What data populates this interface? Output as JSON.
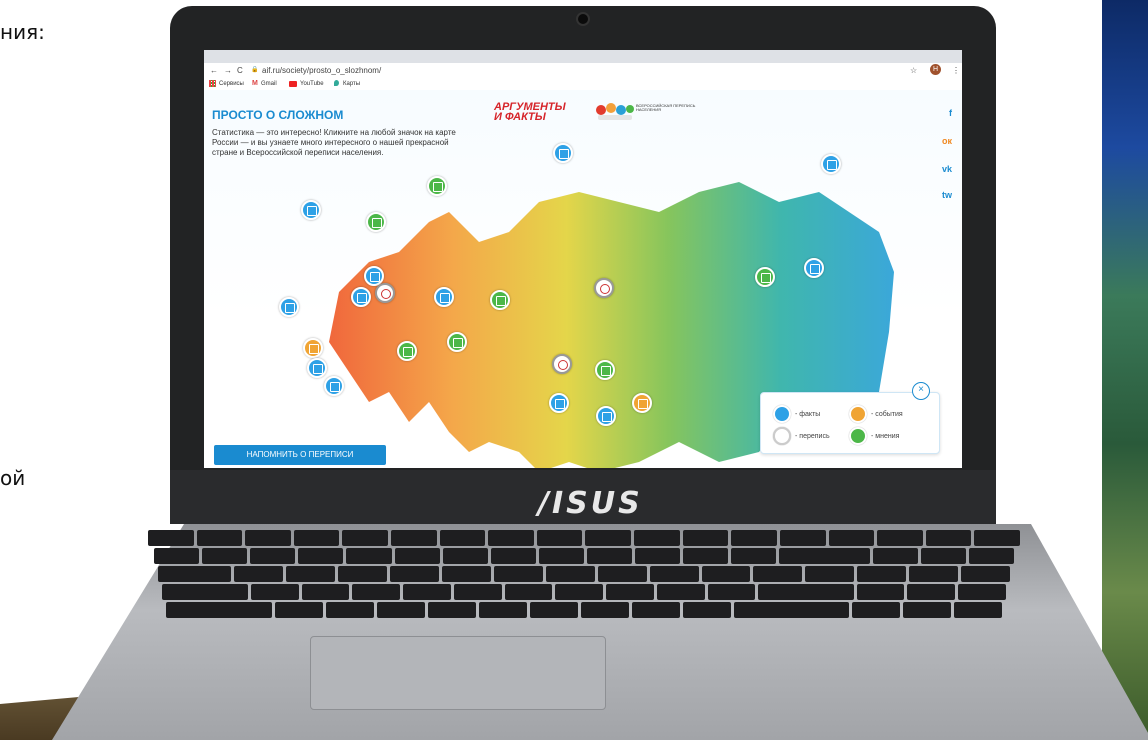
{
  "side_text": {
    "top": "ния:",
    "bottom": "ой"
  },
  "laptop": {
    "brand": "/ISUS"
  },
  "browser": {
    "url": "aif.ru/society/prosto_o_slozhnom/",
    "nav_back": "←",
    "nav_forward": "→",
    "reload": "C",
    "lock": "🔒",
    "star": "☆",
    "avatar": "Н",
    "menu": "⋮",
    "bookmarks": [
      "Сервисы",
      "Gmail",
      "YouTube",
      "Карты"
    ]
  },
  "page": {
    "title": "ПРОСТО О СЛОЖНОМ",
    "intro": "Статистика — это интересно! Кликните на любой значок на карте России — и вы узнаете много интересного о нашей прекрасной стране и Всероссийской переписи населения.",
    "aif_logo_line1": "АРГУМЕНТЫ",
    "aif_logo_line2": "И ФАКТЫ",
    "census_logo_text": "ВСЕРОССИЙСКАЯ ПЕРЕПИСЬ НАСЕЛЕНИЯ",
    "social": [
      "f",
      "ок",
      "vk",
      "tw"
    ],
    "remind_button": "НАПОМНИТЬ О ПЕРЕПИСИ",
    "legend": {
      "facts": "- факты",
      "events": "- события",
      "census": "- перепись",
      "opinions": "- мнения",
      "close": "×"
    }
  },
  "colors": {
    "accent": "#1a8bd0",
    "facts": "#2ea1e6",
    "opinions": "#4cb748",
    "events": "#f0a434",
    "census": "#ffffff",
    "map_gradient": [
      "#ef5a2b",
      "#f3a03a",
      "#e2d23a",
      "#7cc04e",
      "#2fb0a6",
      "#2aa0d6"
    ]
  }
}
